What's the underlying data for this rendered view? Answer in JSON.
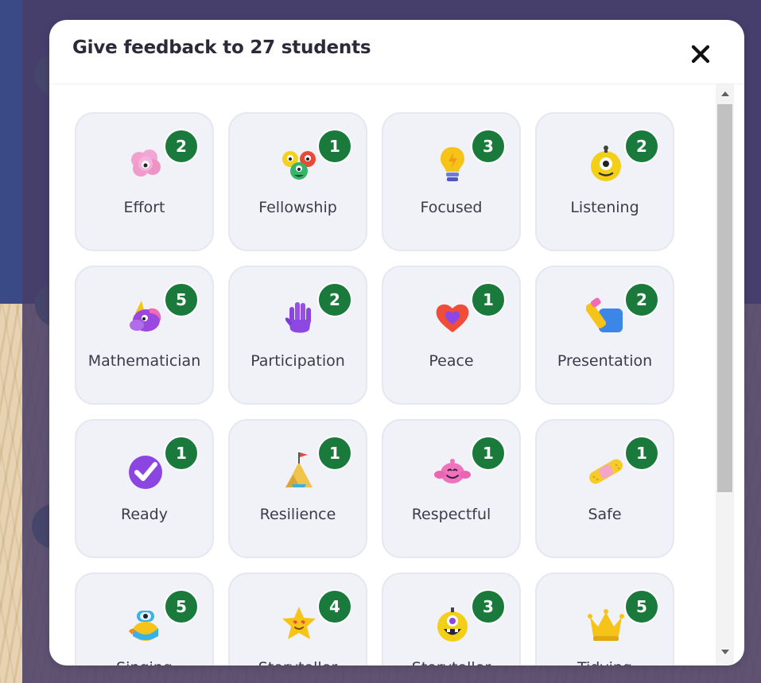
{
  "modal": {
    "title": "Give feedback to 27 students"
  },
  "skills": [
    {
      "label": "Effort",
      "count": "2",
      "icon": "brain-icon"
    },
    {
      "label": "Fellowship",
      "count": "1",
      "icon": "monster-group-icon"
    },
    {
      "label": "Focused",
      "count": "3",
      "icon": "lightbulb-icon"
    },
    {
      "label": "Listening",
      "count": "2",
      "icon": "one-eyed-monster-icon"
    },
    {
      "label": "Mathematician",
      "count": "5",
      "icon": "unicorn-icon"
    },
    {
      "label": "Participation",
      "count": "2",
      "icon": "raised-hand-icon"
    },
    {
      "label": "Peace",
      "count": "1",
      "icon": "heart-icon"
    },
    {
      "label": "Presentation",
      "count": "2",
      "icon": "marker-icon"
    },
    {
      "label": "Ready",
      "count": "1",
      "icon": "check-circle-icon"
    },
    {
      "label": "Resilience",
      "count": "1",
      "icon": "mountain-flag-icon"
    },
    {
      "label": "Respectful",
      "count": "1",
      "icon": "pink-monster-icon"
    },
    {
      "label": "Safe",
      "count": "1",
      "icon": "bandage-icon"
    },
    {
      "label": "Singing",
      "count": "5",
      "icon": "diver-monster-icon"
    },
    {
      "label": "Storyteller",
      "count": "4",
      "icon": "star-icon"
    },
    {
      "label": "Storyteller",
      "count": "3",
      "icon": "yellow-monster-icon"
    },
    {
      "label": "Tidying",
      "count": "5",
      "icon": "crown-icon"
    }
  ],
  "colors": {
    "badge": "#1a7a3c",
    "card_bg": "#f1f2f8",
    "overlay": "#483e68",
    "header_blue": "#3a4a86"
  }
}
